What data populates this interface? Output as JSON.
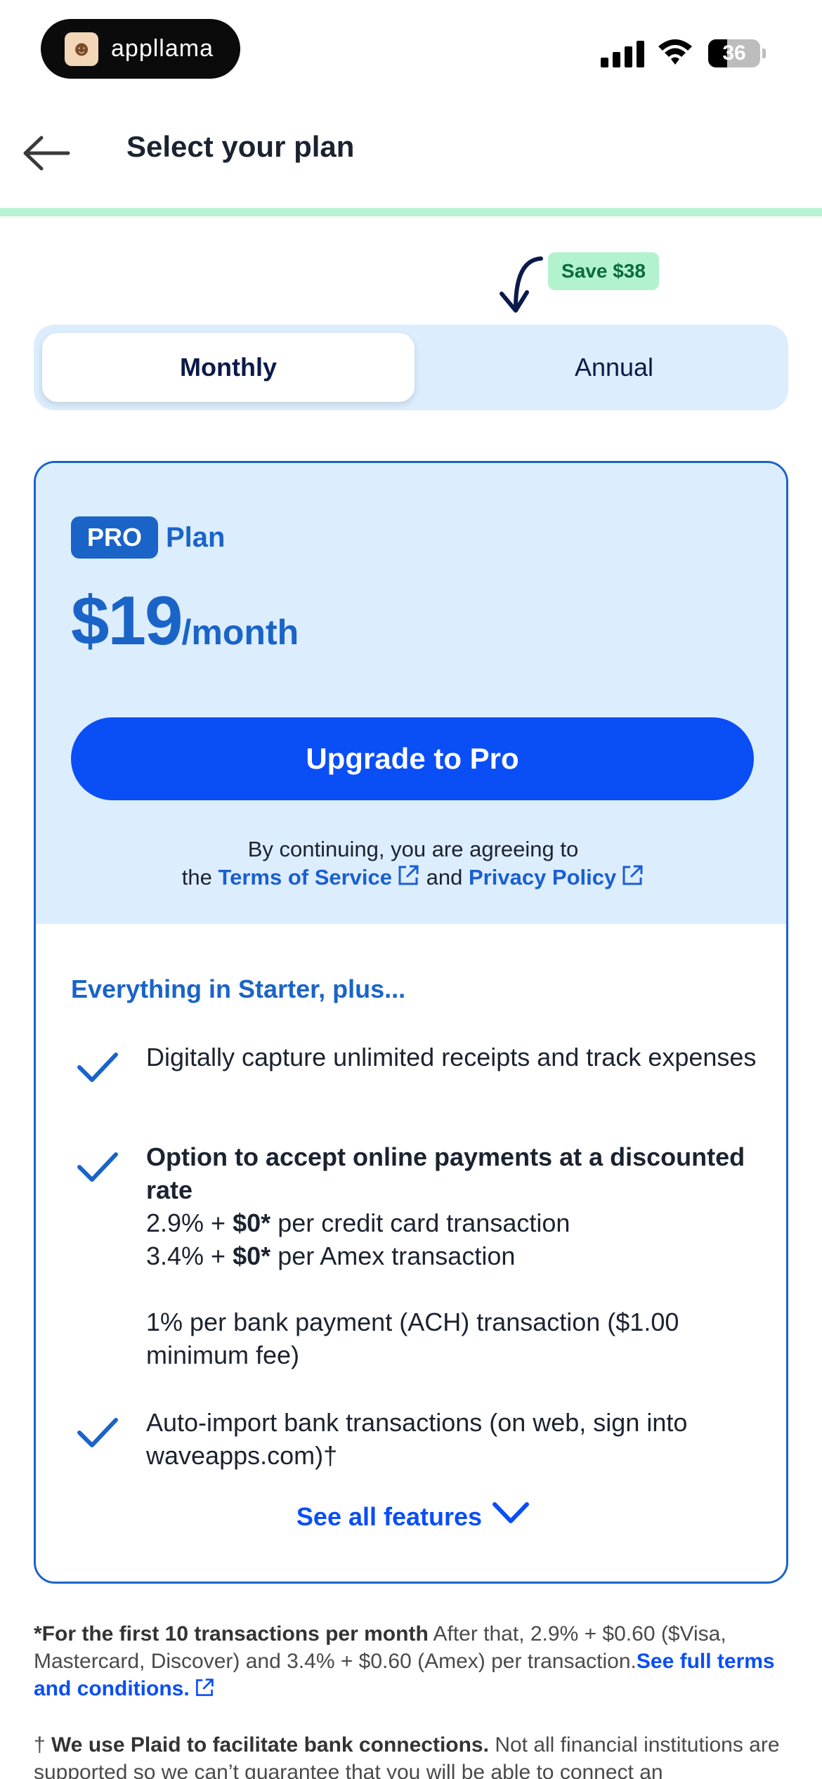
{
  "status_bar": {
    "app_name": "appllama",
    "battery_level": "36",
    "battery_fraction": 0.36
  },
  "header": {
    "title": "Select your plan",
    "back_icon": "arrow-left-icon",
    "progress_fraction": 1.0
  },
  "billing_toggle": {
    "save_badge": "Save $38",
    "options": [
      "Monthly",
      "Annual"
    ],
    "selected": "Monthly"
  },
  "plan": {
    "badge": "PRO",
    "name": "Plan",
    "price": "$19",
    "period": "/month",
    "cta_label": "Upgrade to Pro",
    "agreement": {
      "prefix": "By continuing, you are agreeing to",
      "the": "the",
      "terms_link": "Terms of Service",
      "and": "and",
      "privacy_link": "Privacy Policy"
    },
    "features_heading": "Everything in Starter, plus...",
    "features": [
      {
        "text": "Digitally capture unlimited receipts and track expenses"
      },
      {
        "title": "Option to accept online payments at a discounted rate",
        "line1_prefix": "2.9% +",
        "line1_bold": "$0*",
        "line1_suffix": "per credit card transaction",
        "line2_prefix": "3.4% +",
        "line2_bold": "$0*",
        "line2_suffix": "per Amex transaction",
        "line3": "1% per bank payment (ACH) transaction ($1.00 minimum fee)"
      },
      {
        "text": "Auto-import bank transactions (on web, sign into waveapps.com)†"
      }
    ],
    "see_all_label": "See all features"
  },
  "footnotes": {
    "first_bold": "*For the first 10 transactions per month",
    "first_text": "After that, 2.9% + $0.60 ($Visa, Mastercard, Discover) and 3.4% + $0.60 (Amex) per transaction.",
    "first_link": "See full terms and conditions.",
    "second_dagger": "†",
    "second_bold": "We use Plaid to facilitate bank connections.",
    "second_text": "Not all financial institutions are supported so we can’t guarantee that you will be able to connect an"
  },
  "colors": {
    "brand_blue": "#1a64c8",
    "cta_blue": "#0a4ef5",
    "panel_blue": "#dcedfd",
    "mint": "#b9f3d3",
    "save_green": "#0b6b3a"
  }
}
